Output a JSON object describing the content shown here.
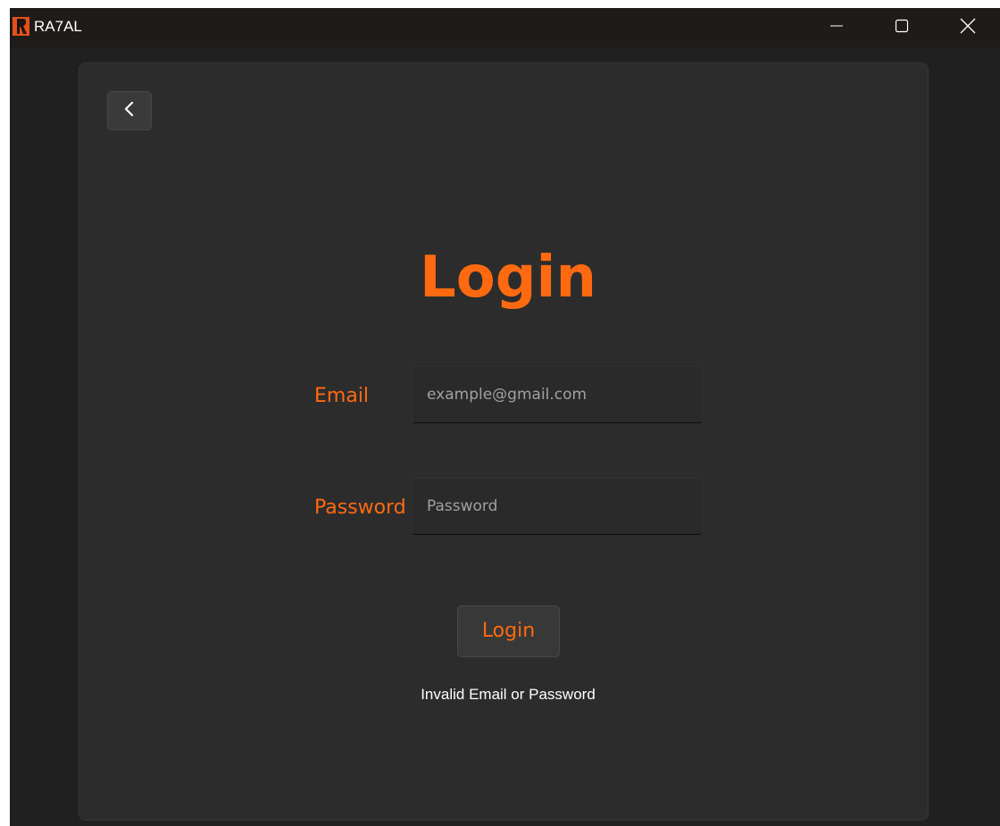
{
  "window": {
    "title": "RA7AL",
    "logo_icon": "app-logo-icon",
    "controls": [
      {
        "name": "minimize",
        "icon": "minimize-icon"
      },
      {
        "name": "maximize",
        "icon": "maximize-icon"
      },
      {
        "name": "close",
        "icon": "close-icon"
      }
    ]
  },
  "colors": {
    "accent": "#ff6a10",
    "background": "#202020",
    "panel": "#2c2c2c",
    "titlebar": "#1f1b19",
    "text": "#ffffff",
    "placeholder": "#a0a0a0"
  },
  "back_button": {
    "icon": "chevron-left-icon"
  },
  "login": {
    "title": "Login",
    "email_label": "Email",
    "email_placeholder": "example@gmail.com",
    "password_label": "Password",
    "password_placeholder": "Password",
    "button_label": "Login",
    "error_message": "Invalid Email or Password"
  }
}
